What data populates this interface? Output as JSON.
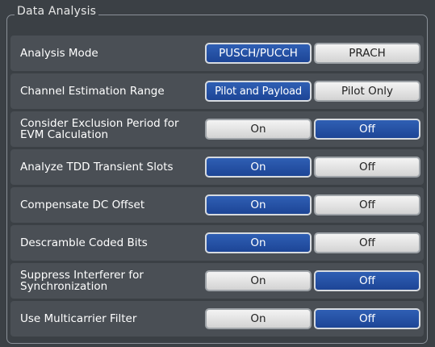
{
  "panel": {
    "title": "Data Analysis"
  },
  "colors": {
    "selected": "#1d4596",
    "unselected": "#e6e6e6",
    "background": "#3b4045"
  },
  "rows": [
    {
      "label": "Analysis Mode",
      "options": [
        "PUSCH/PUCCH",
        "PRACH"
      ],
      "selected": 0
    },
    {
      "label": "Channel Estimation Range",
      "options": [
        "Pilot and Payload",
        "Pilot Only"
      ],
      "selected": 0
    },
    {
      "label": "Consider Exclusion Period for EVM Calculation",
      "options": [
        "On",
        "Off"
      ],
      "selected": 1
    },
    {
      "label": "Analyze TDD Transient Slots",
      "options": [
        "On",
        "Off"
      ],
      "selected": 0
    },
    {
      "label": "Compensate DC Offset",
      "options": [
        "On",
        "Off"
      ],
      "selected": 0
    },
    {
      "label": "Descramble Coded Bits",
      "options": [
        "On",
        "Off"
      ],
      "selected": 0
    },
    {
      "label": "Suppress Interferer for Synchronization",
      "options": [
        "On",
        "Off"
      ],
      "selected": 1
    },
    {
      "label": "Use Multicarrier Filter",
      "options": [
        "On",
        "Off"
      ],
      "selected": 1
    }
  ]
}
